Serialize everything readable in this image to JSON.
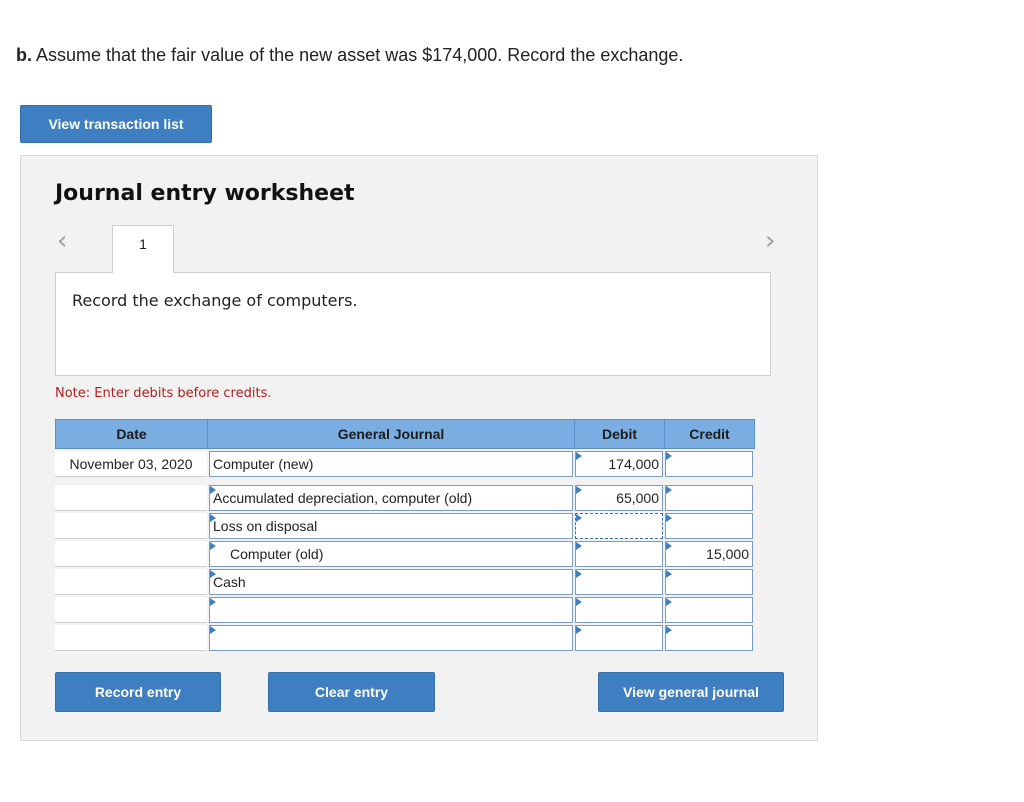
{
  "question": {
    "label": "b.",
    "text": "Assume that the fair value of the new asset was $174,000. Record the exchange."
  },
  "buttons": {
    "view_transaction_list": "View transaction list",
    "record_entry": "Record entry",
    "clear_entry": "Clear entry",
    "view_general_journal": "View general journal"
  },
  "worksheet": {
    "title": "Journal entry worksheet",
    "tab_number": "1",
    "prev_icon": "chevron-left-icon",
    "next_icon": "chevron-right-icon",
    "description": "Record the exchange of computers.",
    "note": "Note: Enter debits before credits."
  },
  "table": {
    "headers": [
      "Date",
      "General Journal",
      "Debit",
      "Credit"
    ],
    "rows": [
      {
        "date": "November 03, 2020",
        "account": "Computer (new)",
        "debit": "174,000",
        "credit": "",
        "indent": false
      },
      {
        "date": "",
        "account": "Accumulated depreciation, computer (old)",
        "debit": "65,000",
        "credit": "",
        "indent": false
      },
      {
        "date": "",
        "account": "Loss on disposal",
        "debit": "",
        "credit": "",
        "indent": false
      },
      {
        "date": "",
        "account": "Computer (old)",
        "debit": "",
        "credit": "15,000",
        "indent": true
      },
      {
        "date": "",
        "account": "Cash",
        "debit": "",
        "credit": "",
        "indent": false
      },
      {
        "date": "",
        "account": "",
        "debit": "",
        "credit": "",
        "indent": false
      },
      {
        "date": "",
        "account": "",
        "debit": "",
        "credit": "",
        "indent": false
      }
    ]
  },
  "colors": {
    "button_blue": "#3d7fc1",
    "header_blue": "#7aaee3",
    "note_red": "#b02020",
    "panel_gray": "#f2f2f2"
  }
}
